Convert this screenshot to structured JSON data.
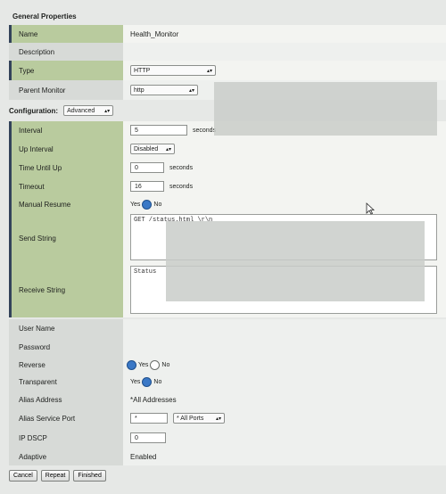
{
  "general": {
    "title": "General Properties",
    "name_label": "Name",
    "name_value": "Health_Monitor",
    "description_label": "Description",
    "type_label": "Type",
    "type_value": "HTTP",
    "parent_label": "Parent Monitor",
    "parent_value": "http"
  },
  "configuration": {
    "title": "Configuration:",
    "mode_value": "Advanced",
    "interval_label": "Interval",
    "interval_value": "5",
    "interval_unit": "seconds",
    "up_interval_label": "Up Interval",
    "up_interval_value": "Disabled",
    "time_until_up_label": "Time Until Up",
    "time_until_up_value": "0",
    "time_until_up_unit": "seconds",
    "timeout_label": "Timeout",
    "timeout_value": "16",
    "timeout_unit": "seconds",
    "manual_resume_label": "Manual Resume",
    "manual_resume_yes": "Yes",
    "manual_resume_no": "No",
    "send_string_label": "Send String",
    "send_string_value": "GET /status.html \\r\\n",
    "receive_string_label": "Receive String",
    "receive_string_value": "Status",
    "user_name_label": "User Name",
    "password_label": "Password",
    "reverse_label": "Reverse",
    "reverse_yes": "Yes",
    "reverse_no": "No",
    "transparent_label": "Transparent",
    "transparent_yes": "Yes",
    "transparent_no": "No",
    "alias_address_label": "Alias Address",
    "alias_address_value": "*All Addresses",
    "alias_port_label": "Alias Service Port",
    "alias_port_value": "*",
    "alias_port_select": "* All Ports",
    "ip_dscp_label": "IP DSCP",
    "ip_dscp_value": "0",
    "adaptive_label": "Adaptive",
    "adaptive_value": "Enabled"
  },
  "buttons": {
    "cancel": "Cancel",
    "repeat": "Repeat",
    "finished": "Finished"
  }
}
